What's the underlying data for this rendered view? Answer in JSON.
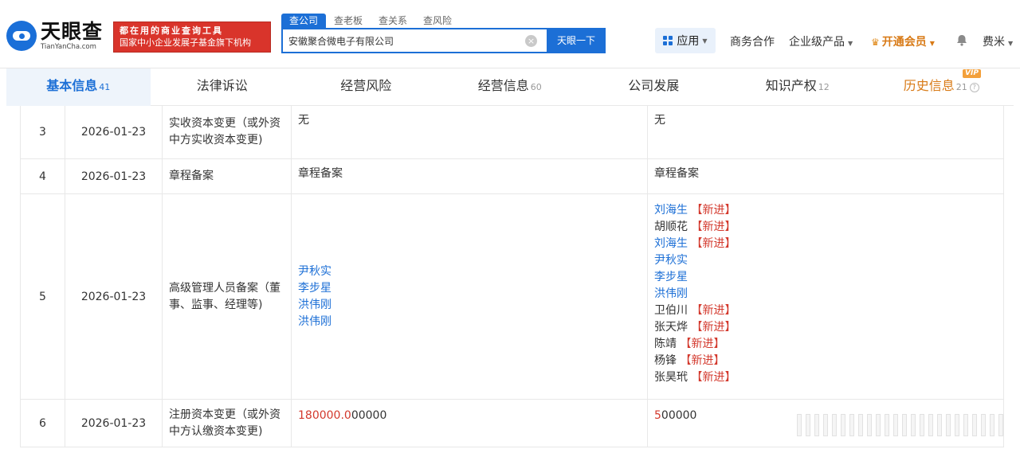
{
  "logo": {
    "cn": "天眼查",
    "en": "TianYanCha.com"
  },
  "slogan": {
    "line1": "都在用的商业查询工具",
    "line2": "国家中小企业发展子基金旗下机构"
  },
  "search_tabs": [
    "查公司",
    "查老板",
    "查关系",
    "查风险"
  ],
  "search": {
    "value": "安徽聚合微电子有限公司",
    "button": "天眼一下"
  },
  "nav": {
    "apps": "应用",
    "biz": "商务合作",
    "enterprise": "企业级产品",
    "vip": "开通会员",
    "user": "费米"
  },
  "content_tabs": [
    {
      "label": "基本信息",
      "count": "41"
    },
    {
      "label": "法律诉讼",
      "count": ""
    },
    {
      "label": "经营风险",
      "count": ""
    },
    {
      "label": "经营信息",
      "count": "60"
    },
    {
      "label": "公司发展",
      "count": ""
    },
    {
      "label": "知识产权",
      "count": "12"
    },
    {
      "label": "历史信息",
      "count": "21",
      "badge": "VIP"
    }
  ],
  "rows": [
    {
      "no": "3",
      "date": "2026-01-23",
      "item": "实收资本变更（或外资中方实收资本变更)",
      "before": "无",
      "after": "无"
    },
    {
      "no": "4",
      "date": "2026-01-23",
      "item": "章程备案",
      "before": "章程备案",
      "after": "章程备案"
    },
    {
      "no": "5",
      "date": "2026-01-23",
      "item": "高级管理人员备案（董事、监事、经理等)",
      "before_names": [
        "尹秋实",
        "李步星",
        "洪伟刚",
        "洪伟刚"
      ],
      "after_names": [
        {
          "name": "刘海生",
          "tag": "【新进】",
          "link": true
        },
        {
          "name": "胡顺花",
          "tag": "【新进】",
          "link": false
        },
        {
          "name": "刘海生",
          "tag": "【新进】",
          "link": true
        },
        {
          "name": "尹秋实",
          "tag": "",
          "link": true
        },
        {
          "name": "李步星",
          "tag": "",
          "link": true
        },
        {
          "name": "洪伟刚",
          "tag": "",
          "link": true
        },
        {
          "name": "卫伯川",
          "tag": "【新进】",
          "link": false
        },
        {
          "name": "张天烨",
          "tag": "【新进】",
          "link": false
        },
        {
          "name": "陈靖",
          "tag": "【新进】",
          "link": false
        },
        {
          "name": "杨锋",
          "tag": "【新进】",
          "link": false
        },
        {
          "name": "张昊玳",
          "tag": "【新进】",
          "link": false
        }
      ]
    },
    {
      "no": "6",
      "date": "2026-01-23",
      "item": "注册资本变更（或外资中方认缴资本变更)",
      "before_red": "180000.0",
      "before_rest": "00000",
      "after_red": "5",
      "after_rest": "00000"
    }
  ],
  "colors": {
    "brand": "#1c6fd6",
    "slogan_bg": "#d9342b",
    "new_tag": "#d3382c",
    "vip": "#d87a16"
  }
}
